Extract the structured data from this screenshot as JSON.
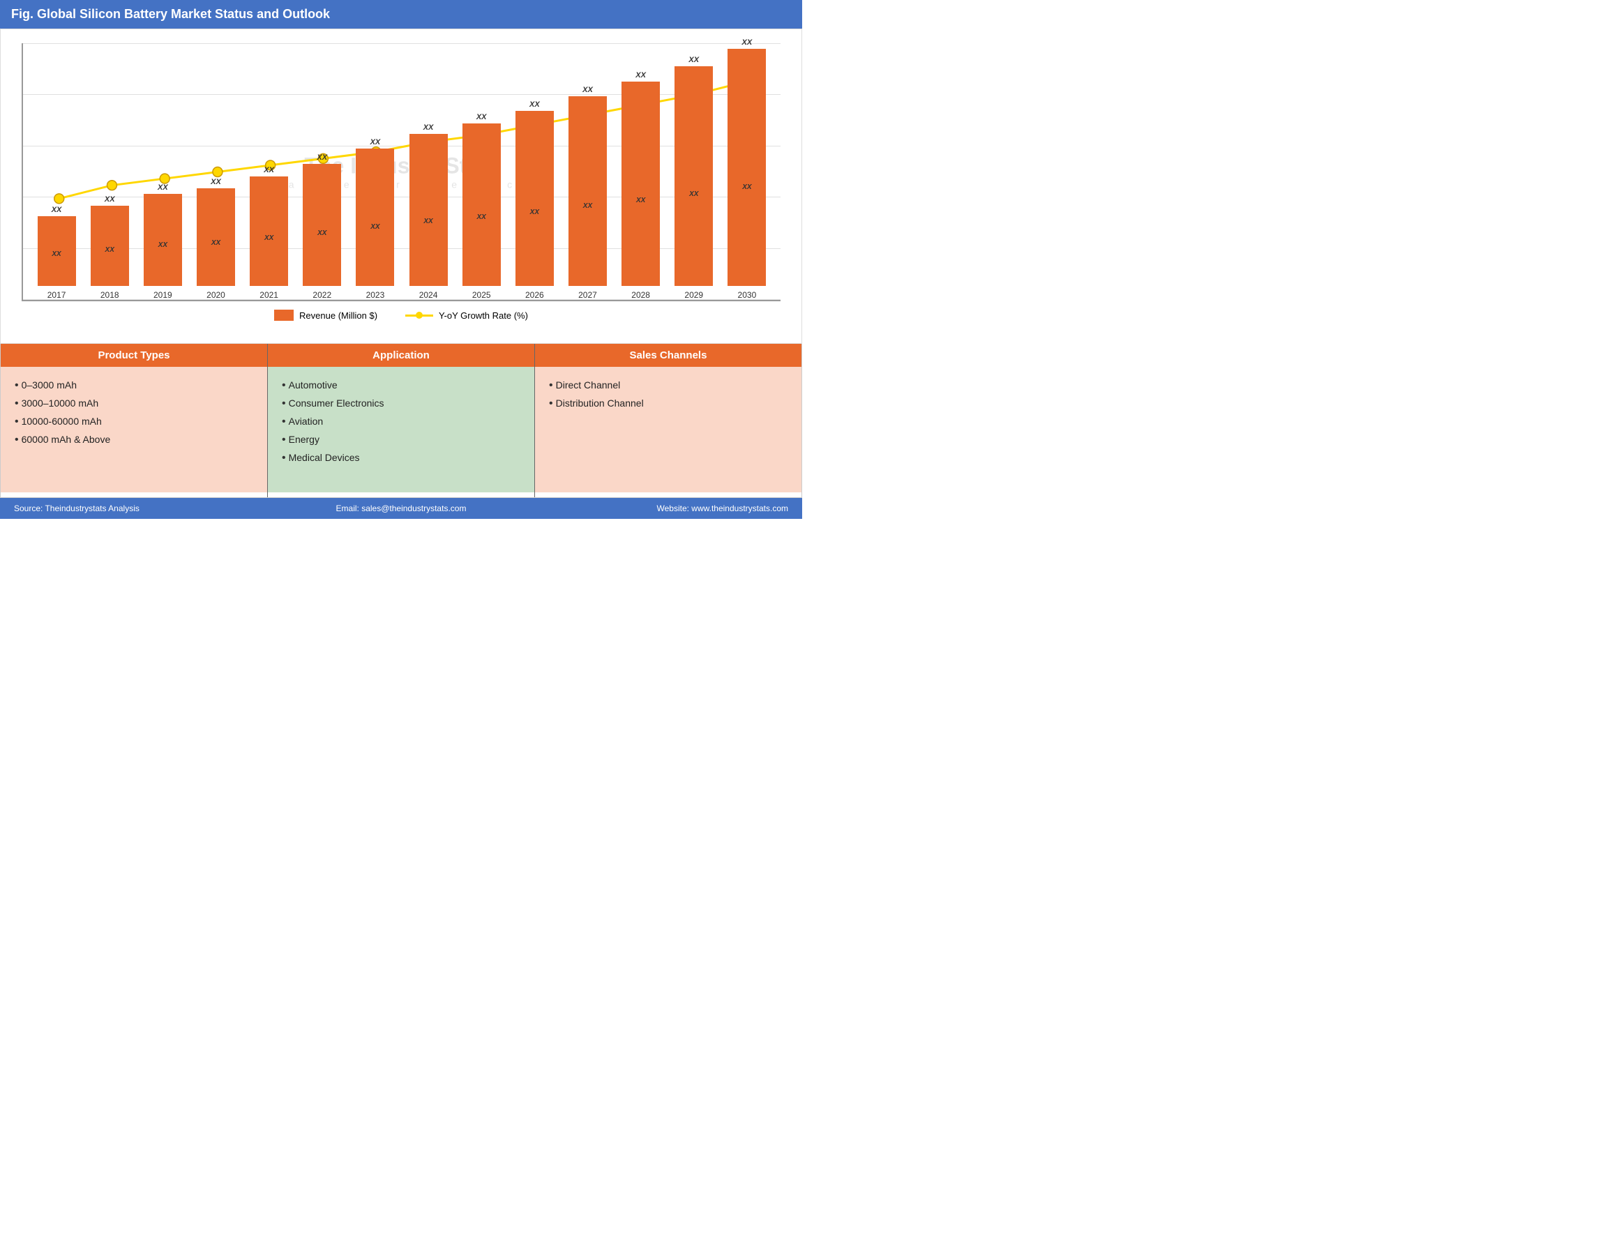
{
  "header": {
    "title": "Fig. Global Silicon Battery Market Status and Outlook"
  },
  "chart": {
    "bars": [
      {
        "year": "2017",
        "height_pct": 28,
        "top_label": "XX",
        "mid_label": "XX"
      },
      {
        "year": "2018",
        "height_pct": 32,
        "top_label": "XX",
        "mid_label": "XX"
      },
      {
        "year": "2019",
        "height_pct": 37,
        "top_label": "XX",
        "mid_label": "XX"
      },
      {
        "year": "2020",
        "height_pct": 39,
        "top_label": "XX",
        "mid_label": "XX"
      },
      {
        "year": "2021",
        "height_pct": 44,
        "top_label": "XX",
        "mid_label": "XX"
      },
      {
        "year": "2022",
        "height_pct": 49,
        "top_label": "XX",
        "mid_label": "XX"
      },
      {
        "year": "2023",
        "height_pct": 55,
        "top_label": "XX",
        "mid_label": "XX"
      },
      {
        "year": "2024",
        "height_pct": 61,
        "top_label": "XX",
        "mid_label": "XX"
      },
      {
        "year": "2025",
        "height_pct": 65,
        "top_label": "XX",
        "mid_label": "XX"
      },
      {
        "year": "2026",
        "height_pct": 70,
        "top_label": "XX",
        "mid_label": "XX"
      },
      {
        "year": "2027",
        "height_pct": 76,
        "top_label": "XX",
        "mid_label": "XX"
      },
      {
        "year": "2028",
        "height_pct": 82,
        "top_label": "XX",
        "mid_label": "XX"
      },
      {
        "year": "2029",
        "height_pct": 88,
        "top_label": "XX",
        "mid_label": "XX"
      },
      {
        "year": "2030",
        "height_pct": 95,
        "top_label": "XX",
        "mid_label": "XX"
      }
    ],
    "line_points": [
      22,
      26,
      28,
      30,
      32,
      34,
      36,
      39,
      41,
      44,
      47,
      50,
      53,
      57
    ],
    "legend": {
      "bar_label": "Revenue (Million $)",
      "line_label": "Y-oY Growth Rate (%)"
    },
    "watermark": {
      "main": "The Industry Stats",
      "sub": "m a r k e t   r e s e a r c h"
    }
  },
  "product_types": {
    "header": "Product Types",
    "items": [
      "0–3000 mAh",
      "3000–10000 mAh",
      "10000-60000 mAh",
      "60000 mAh & Above"
    ]
  },
  "application": {
    "header": "Application",
    "items": [
      "Automotive",
      "Consumer Electronics",
      "Aviation",
      "Energy",
      "Medical Devices"
    ]
  },
  "sales_channels": {
    "header": "Sales Channels",
    "items": [
      "Direct Channel",
      "Distribution Channel"
    ]
  },
  "footer": {
    "source": "Source: Theindustrystats Analysis",
    "email": "Email: sales@theindustrystats.com",
    "website": "Website: www.theindustrystats.com"
  }
}
